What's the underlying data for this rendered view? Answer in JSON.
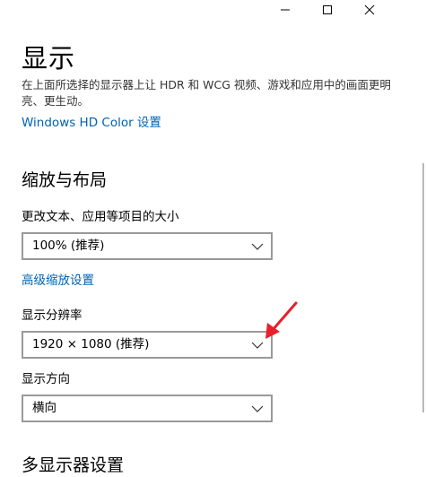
{
  "window": {
    "controls": {
      "minimize_icon": "minimize-icon",
      "maximize_icon": "maximize-icon",
      "close_icon": "close-icon"
    }
  },
  "page": {
    "title": "显示",
    "description": "在上面所选择的显示器上让 HDR 和 WCG 视频、游戏和应用中的画面更明亮、更生动。",
    "hdr_link": "Windows HD Color 设置"
  },
  "scale_layout": {
    "heading": "缩放与布局",
    "text_size_label": "更改文本、应用等项目的大小",
    "text_size_value": "100% (推荐)",
    "advanced_link": "高级缩放设置",
    "resolution_label": "显示分辨率",
    "resolution_value": "1920 × 1080 (推荐)",
    "orientation_label": "显示方向",
    "orientation_value": "横向"
  },
  "multi_display": {
    "heading": "多显示器设置"
  },
  "colors": {
    "link": "#0063b1",
    "dropdown_border": "#999999",
    "annotation_arrow": "#e8202a"
  }
}
